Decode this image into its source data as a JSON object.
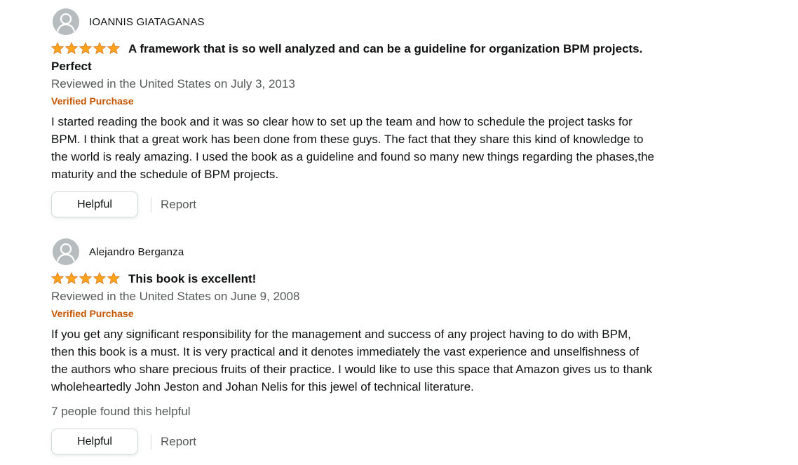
{
  "reviews": [
    {
      "author": "IOANNIS GIATAGANAS",
      "rating": 5,
      "rating_max": 5,
      "title": "A framework that is so well analyzed and can be a guideline for organization BPM projects. Perfect",
      "reviewed_line": "Reviewed in the United States on July 3, 2013",
      "badge": "Verified Purchase",
      "body": "I started reading the book and it was so clear how to set up the team and how to schedule the project tasks for BPM. I think that a great work has been done from these guys. The fact that they share this kind of knowledge to the world is realy amazing. I used the book as a guideline and found so many new things regarding the phases,the maturity and the schedule of BPM projects.",
      "helpful_label": "Helpful",
      "report_label": "Report"
    },
    {
      "author": "Alejandro Berganza",
      "rating": 5,
      "rating_max": 5,
      "title": "This book is excellent!",
      "reviewed_line": "Reviewed in the United States on June 9, 2008",
      "badge": "Verified Purchase",
      "body": "If you get any significant responsibility for the management and success of any project having to do with BPM, then this book is a must. It is very practical and it denotes immediately the vast experience and unselfishness of the authors who share precious fruits of their practice. I would like to use this space that Amazon gives us to thank wholeheartedly John Jeston and Johan Nelis for this jewel of technical literature.",
      "helpful_count": "7 people found this helpful",
      "helpful_label": "Helpful",
      "report_label": "Report"
    }
  ],
  "colors": {
    "star": "#ffa41c",
    "star_outline": "#de7921",
    "verified": "#c45500",
    "meta": "#565959",
    "text": "#0f1111",
    "avatar_bg": "#b7bcbe"
  },
  "icons": {
    "avatar": "avatar-silhouette-icon",
    "star": "star-icon"
  }
}
